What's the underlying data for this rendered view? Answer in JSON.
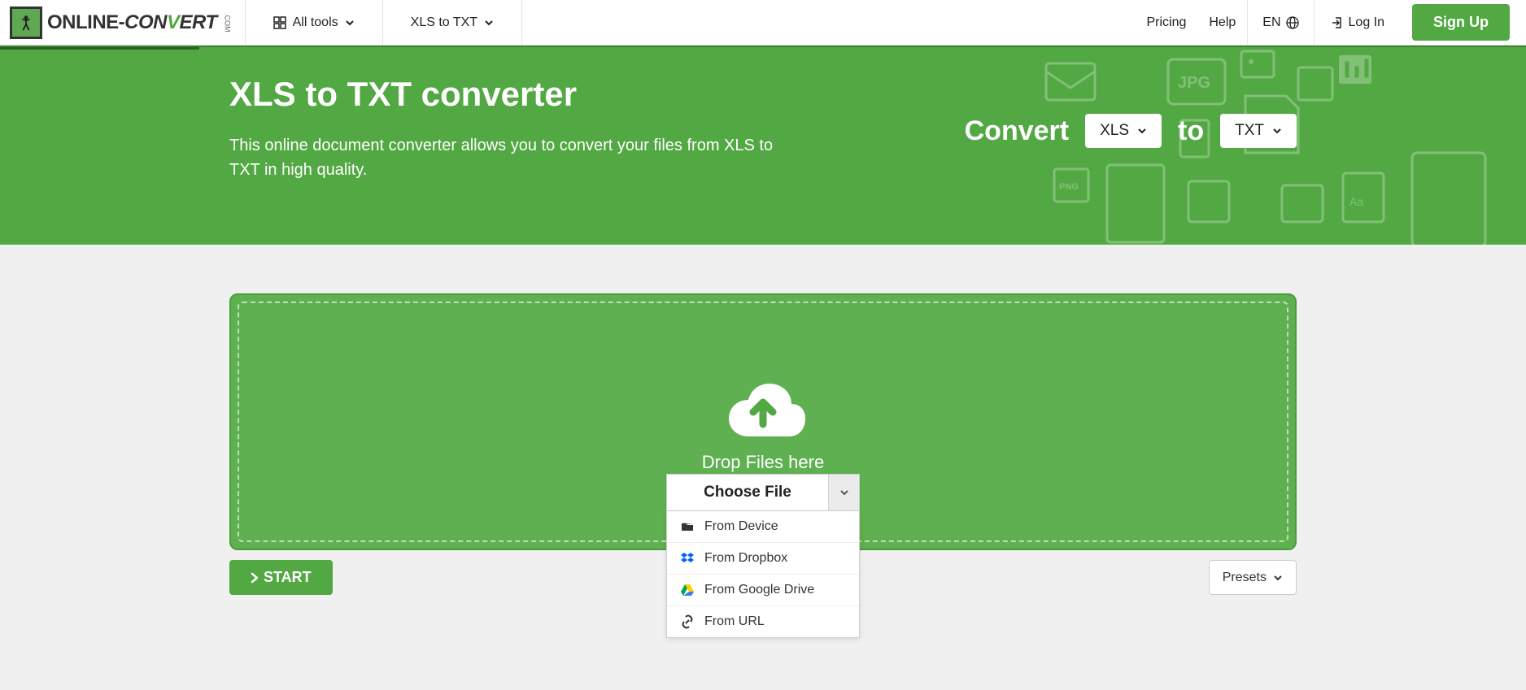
{
  "header": {
    "logo_online": "ONLINE-",
    "logo_con": "CON",
    "logo_v": "V",
    "logo_ert": "ERT",
    "logo_com": ".COM",
    "all_tools": "All tools",
    "current_conv": "XLS to TXT",
    "pricing": "Pricing",
    "help": "Help",
    "lang": "EN",
    "login": "Log In",
    "signup": "Sign Up"
  },
  "hero": {
    "title": "XLS to TXT converter",
    "desc": "This online document converter allows you to convert your files from XLS to TXT in high quality.",
    "convert_label": "Convert",
    "from_format": "XLS",
    "to_label": "to",
    "to_format": "TXT"
  },
  "upload": {
    "drop_text": "Drop Files here",
    "choose_file": "Choose File",
    "options": {
      "device": "From Device",
      "dropbox": "From Dropbox",
      "gdrive": "From Google Drive",
      "url": "From URL"
    }
  },
  "actions": {
    "start": "START",
    "presets": "Presets"
  }
}
